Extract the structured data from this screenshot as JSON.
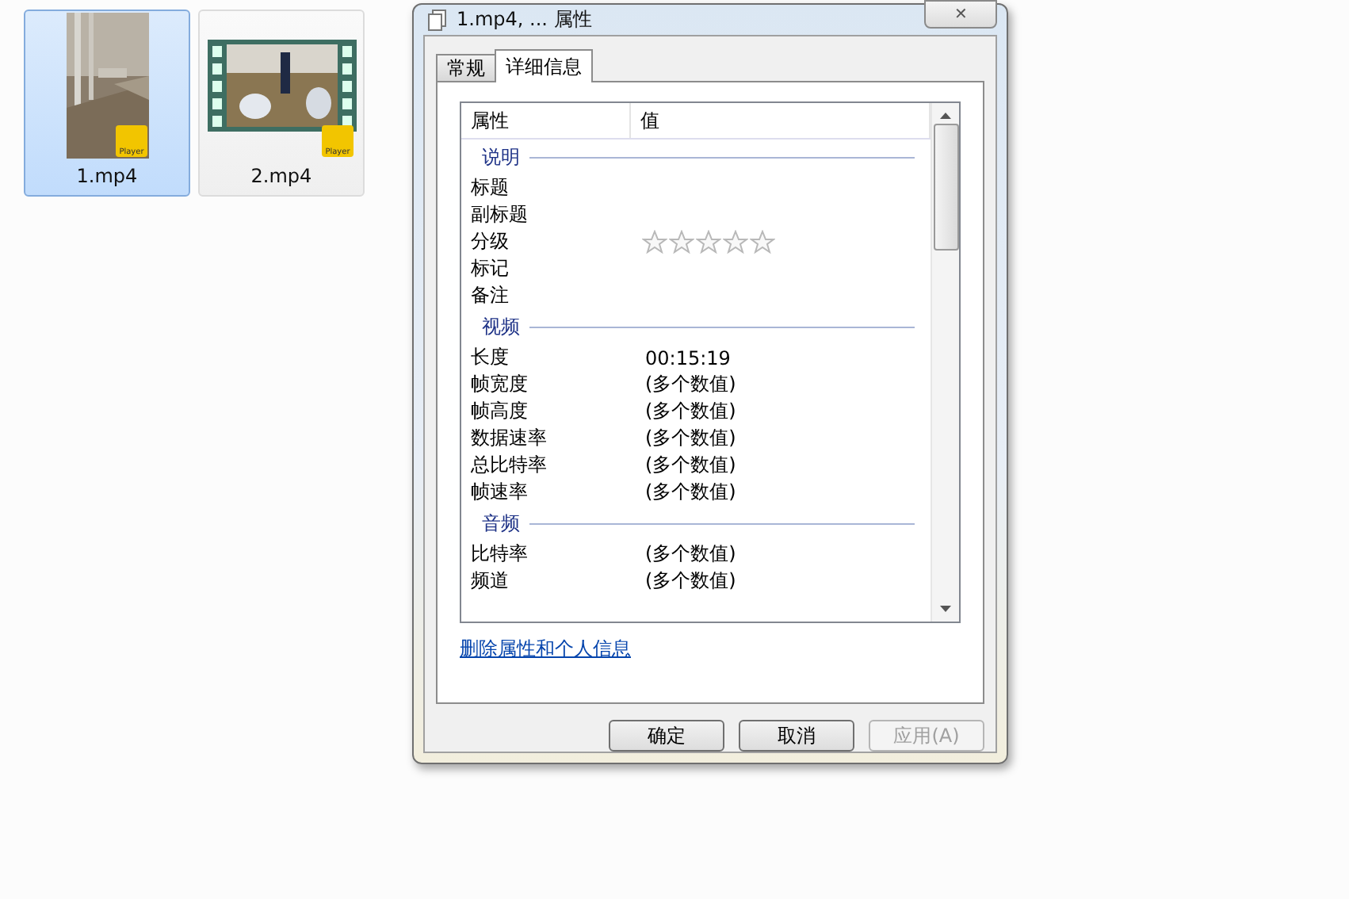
{
  "files": [
    {
      "name": "1.mp4",
      "selected": true,
      "badge": "Player"
    },
    {
      "name": "2.mp4",
      "selected": false,
      "badge": "Player"
    }
  ],
  "dialog": {
    "title": "1.mp4, ... 属性",
    "close": "✕",
    "tabs": [
      {
        "label": "常规",
        "selected": false
      },
      {
        "label": "详细信息",
        "selected": true
      }
    ],
    "columns": [
      "属性",
      "值"
    ],
    "rows": [
      {
        "kind": "section",
        "label": "说明"
      },
      {
        "kind": "property",
        "label": "标题"
      },
      {
        "kind": "property",
        "label": "副标题"
      },
      {
        "kind": "rating",
        "label": "分级",
        "stars": 0
      },
      {
        "kind": "property",
        "label": "标记"
      },
      {
        "kind": "property",
        "label": "备注"
      },
      {
        "kind": "section",
        "label": "视频"
      },
      {
        "kind": "property",
        "label": "长度",
        "value": "00:15:19"
      },
      {
        "kind": "property",
        "label": "帧宽度",
        "value": "(多个数值)"
      },
      {
        "kind": "property",
        "label": "帧高度",
        "value": "(多个数值)"
      },
      {
        "kind": "property",
        "label": "数据速率",
        "value": "(多个数值)"
      },
      {
        "kind": "property",
        "label": "总比特率",
        "value": "(多个数值)"
      },
      {
        "kind": "property",
        "label": "帧速率",
        "value": "(多个数值)"
      },
      {
        "kind": "section",
        "label": "音频"
      },
      {
        "kind": "property",
        "label": "比特率",
        "value": "(多个数值)"
      },
      {
        "kind": "property",
        "label": "频道",
        "value": "(多个数值)"
      }
    ],
    "link": "删除属性和个人信息",
    "buttons": [
      {
        "label": "确定",
        "disabled": false
      },
      {
        "label": "取消",
        "disabled": false
      },
      {
        "label": "应用(A)",
        "disabled": true
      }
    ]
  }
}
